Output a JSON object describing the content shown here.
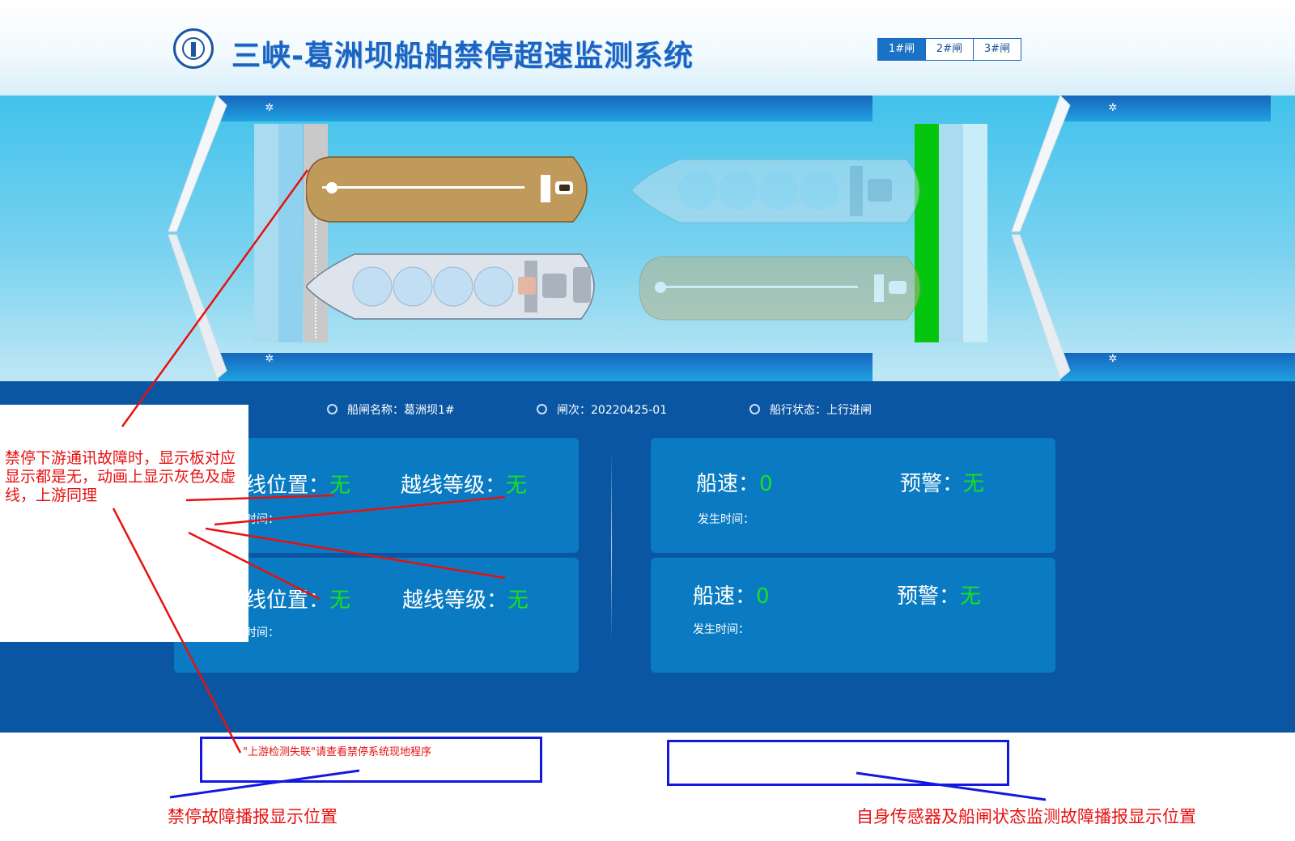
{
  "header": {
    "title": "三峡-葛洲坝船舶禁停超速监测系统",
    "tabs": [
      {
        "label": "1#闸",
        "active": true
      },
      {
        "label": "2#闸",
        "active": false
      },
      {
        "label": "3#闸",
        "active": false
      }
    ]
  },
  "status": {
    "lock_name_label": "船闸名称：",
    "lock_name": "葛洲坝1#",
    "lock_no_label": "闸次：",
    "lock_no": "20220425-01",
    "nav_label": "船行状态：",
    "nav_state": "上行进闸"
  },
  "cards": {
    "left_top": {
      "pos_label": "线位置：",
      "pos_value": "无",
      "level_label": "越线等级：",
      "level_value": "无",
      "time_label": "时间："
    },
    "left_bottom": {
      "pos_label": "线位置：",
      "pos_value": "无",
      "level_label": "越线等级：",
      "level_value": "无",
      "time_label": "时间："
    },
    "right_top": {
      "speed_label": "船速：",
      "speed_value": "0",
      "warn_label": "预警：",
      "warn_value": "无",
      "time_label": "发生时间："
    },
    "right_bottom": {
      "speed_label": "船速：",
      "speed_value": "0",
      "warn_label": "预警：",
      "warn_value": "无",
      "time_label": "发生时间："
    }
  },
  "annotations": {
    "note": "禁停下游通讯故障时，显示板对应显示都是无，动画上显示灰色及虚线，上游同理",
    "alert_text": "\"上游检测失联\"请查看禁停系统现地程序",
    "left_label": "禁停故障播报显示位置",
    "right_label": "自身传感器及船闸状态监测故障播报显示位置"
  },
  "colors": {
    "accent_blue": "#1a72c6",
    "panel_blue": "#0a56a2",
    "card_blue": "#0a7bc2",
    "ok_green": "#18e01d",
    "signal_green": "#05c60e",
    "annotation_red": "#e81010",
    "box_blue": "#1218e0"
  }
}
